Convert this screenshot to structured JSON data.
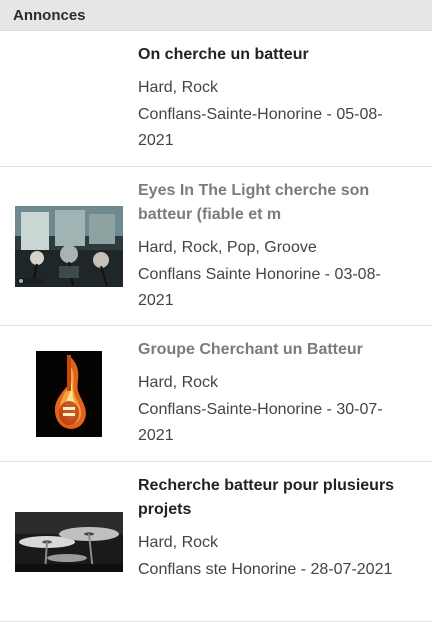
{
  "header": {
    "title": "Annonces"
  },
  "listings": [
    {
      "title": "On cherche un batteur",
      "visited": false,
      "tags": "Hard, Rock",
      "location_date": "Conflans-Sainte-Honorine - 05-08-2021",
      "has_image": false
    },
    {
      "title": "Eyes In The Light cherche son batteur (fiable et m",
      "visited": true,
      "tags": "Hard, Rock, Pop, Groove",
      "location_date": "Conflans Sainte Honorine - 03-08-2021",
      "has_image": true,
      "image": "band-room-photo"
    },
    {
      "title": "Groupe Cherchant un Batteur",
      "visited": true,
      "tags": "Hard, Rock",
      "location_date": "Conflans-Sainte-Honorine - 30-07-2021",
      "has_image": true,
      "image": "flaming-guitar-photo"
    },
    {
      "title": "Recherche batteur pour plusieurs projets",
      "visited": false,
      "tags": "Hard, Rock",
      "location_date": "Conflans ste Honorine - 28-07-2021",
      "has_image": true,
      "image": "cymbals-photo"
    }
  ],
  "colors": {
    "header_bg": "#e6e6e6",
    "title": "#222222",
    "title_visited": "#7b7b7b",
    "body_text": "#444444",
    "divider": "#e3e3e3"
  }
}
